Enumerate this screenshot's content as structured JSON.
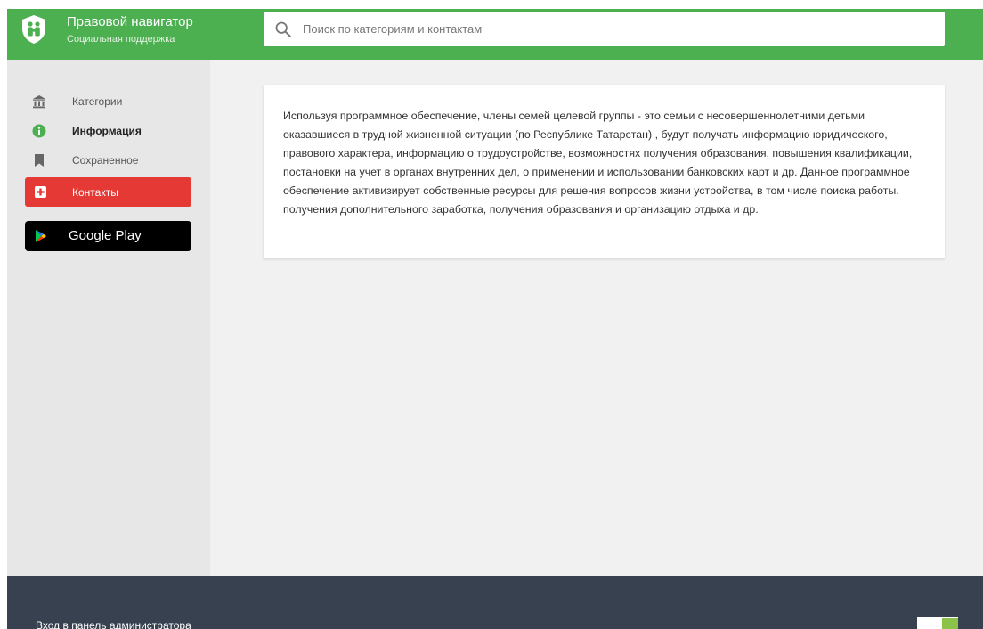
{
  "brand": {
    "title": "Правовой навигатор",
    "subtitle": "Социальная поддержка",
    "logo_icon": "family-shield-icon"
  },
  "search": {
    "placeholder": "Поиск по категориям и контактам",
    "value": "",
    "icon": "search-icon"
  },
  "sidebar": {
    "items": [
      {
        "label": "Категории",
        "icon": "bank-icon",
        "active": false
      },
      {
        "label": "Информация",
        "icon": "info-icon",
        "active": true
      },
      {
        "label": "Сохраненное",
        "icon": "bookmark-icon",
        "active": false
      }
    ],
    "contacts_button": {
      "label": "Контакты",
      "icon": "plus-icon"
    },
    "google_play": {
      "label": "Google Play",
      "icon": "google-play-icon"
    }
  },
  "content": {
    "text": "Используя программное обеспечение, члены семей целевой группы - это семьи с несовершеннолетними детьми оказавшиеся в трудной жизненной ситуации (по Республике Татарстан) , будут получать информацию юридического, правового характера, информацию о трудоустройстве, возможностях получения образования, повышения квалификации, постановки на учет в органах внутренних дел, о применении и использовании банковских карт и др. Данное программное обеспечение активизирует собственные ресурсы для решения вопросов жизни устройства, в том числе поиска работы. получения дополнительного заработка, получения образования и организацию отдыха и др."
  },
  "footer": {
    "admin_link": "Вход в панель администратора"
  },
  "colors": {
    "header": "#4caf50",
    "sidebar": "#e7e7e7",
    "contacts": "#e53935",
    "footer": "#37414f",
    "background": "#f1f1f1"
  }
}
